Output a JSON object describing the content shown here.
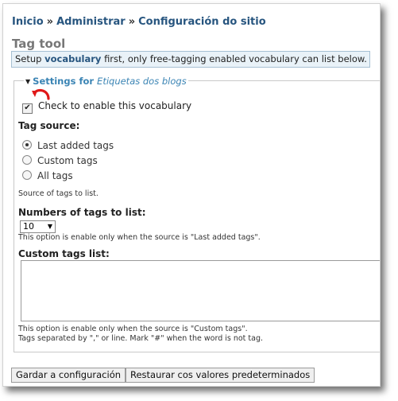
{
  "breadcrumb": {
    "items": [
      "Inicio",
      "Administrar",
      "Configuración do sitio"
    ],
    "separator": "»"
  },
  "page_title": "Tag tool",
  "help": {
    "prefix": "Setup",
    "strong": "vocabulary",
    "suffix": "first, only free-tagging enabled vocabulary can list below."
  },
  "fieldset": {
    "legend_prefix": "Settings for",
    "legend_name": "Etiquetas dos blogs",
    "enable_label": "Check to enable this vocabulary",
    "enable_checked": true
  },
  "tag_source": {
    "label": "Tag source:",
    "options": [
      "Last added tags",
      "Custom tags",
      "All tags"
    ],
    "selected": "Last added tags",
    "description": "Source of tags to list."
  },
  "num_tags": {
    "label": "Numbers of tags to list:",
    "value": "10",
    "description": "This option is enable only when the source is \"Last added tags\"."
  },
  "custom_tags": {
    "label": "Custom tags list:",
    "value": "",
    "description1": "This option is enable only when the source is \"Custom tags\".",
    "description2": "Tags separated by \",\" or line. Mark \"#\" when the word is not tag."
  },
  "buttons": {
    "save": "Gardar a configuración",
    "reset": "Restaurar cos valores predeterminados"
  },
  "colors": {
    "link": "#27557f",
    "legend": "#3a84b4",
    "help_bg": "#e9f2f8",
    "annotation": "#e01818"
  }
}
